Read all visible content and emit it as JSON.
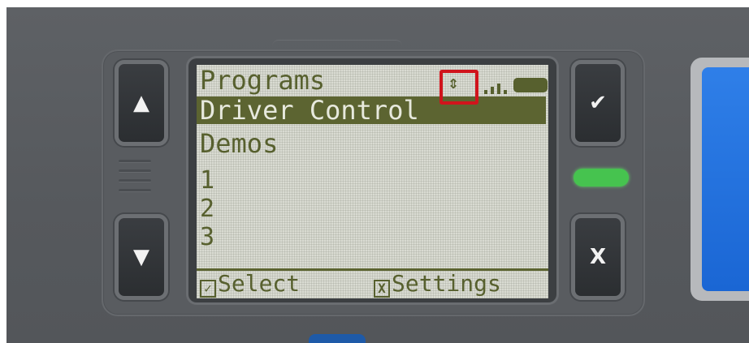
{
  "screen": {
    "title": "Programs",
    "items": [
      {
        "label": "Driver Control",
        "selected": true
      },
      {
        "label": "Demos",
        "selected": false
      },
      {
        "label": "1",
        "selected": false
      },
      {
        "label": "2",
        "selected": false
      },
      {
        "label": "3",
        "selected": false
      }
    ],
    "footer": {
      "left_icon": "✓",
      "left_label": "Select",
      "right_icon": "X",
      "right_label": "Settings"
    }
  },
  "buttons": {
    "up_glyph": "▲",
    "down_glyph": "▼",
    "check_glyph": "✔",
    "x_glyph": "X"
  },
  "status_icons": {
    "scroll": "⇕",
    "signal": "signal-icon",
    "battery": "battery-icon"
  },
  "colors": {
    "lcd_background": "#d9dbd2",
    "lcd_text": "#57602e",
    "selection": "#5c6431",
    "highlight_box": "#d0141c",
    "status_led": "#46c34f",
    "device_body": "#55585c"
  }
}
